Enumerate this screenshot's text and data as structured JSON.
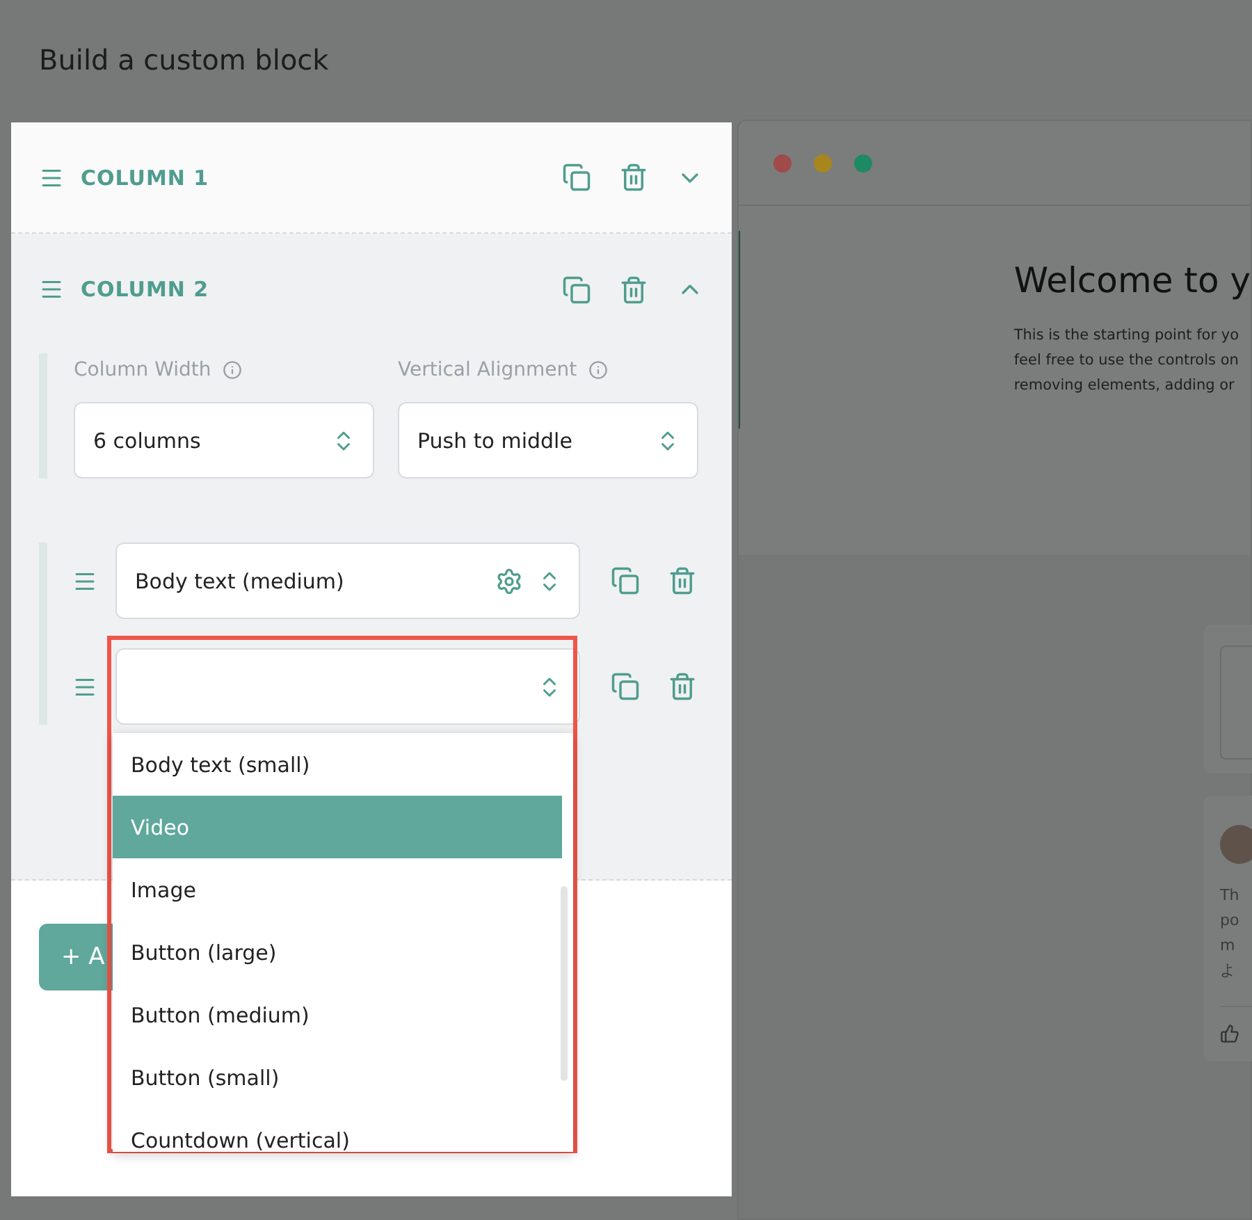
{
  "page_title": "Build a custom block",
  "columns": [
    {
      "title": "COLUMN 1",
      "expanded": false
    },
    {
      "title": "COLUMN 2",
      "expanded": true,
      "settings": [
        {
          "label": "Column Width",
          "value": "6 columns"
        },
        {
          "label": "Vertical Alignment",
          "value": "Push to middle"
        }
      ],
      "elements": [
        {
          "value": "Body text (medium)",
          "settings_icon": true,
          "open": false
        },
        {
          "settings_icon": false,
          "open": true
        }
      ]
    }
  ],
  "dropdown_options": [
    {
      "label": "Body text (small)",
      "selected": false
    },
    {
      "label": "Video",
      "selected": true
    },
    {
      "label": "Image",
      "selected": false
    },
    {
      "label": "Button (large)",
      "selected": false
    },
    {
      "label": "Button (medium)",
      "selected": false
    },
    {
      "label": "Button (small)",
      "selected": false
    },
    {
      "label": "Countdown (vertical)",
      "selected": false
    }
  ],
  "add_button": "+ A",
  "preview": {
    "heading": "Welcome to y",
    "lines": [
      "This is the starting point for yo",
      "feel free to use the controls on",
      "removing elements, adding or"
    ],
    "card_lines": [
      "Th",
      "po",
      "m",
      "よ"
    ]
  }
}
